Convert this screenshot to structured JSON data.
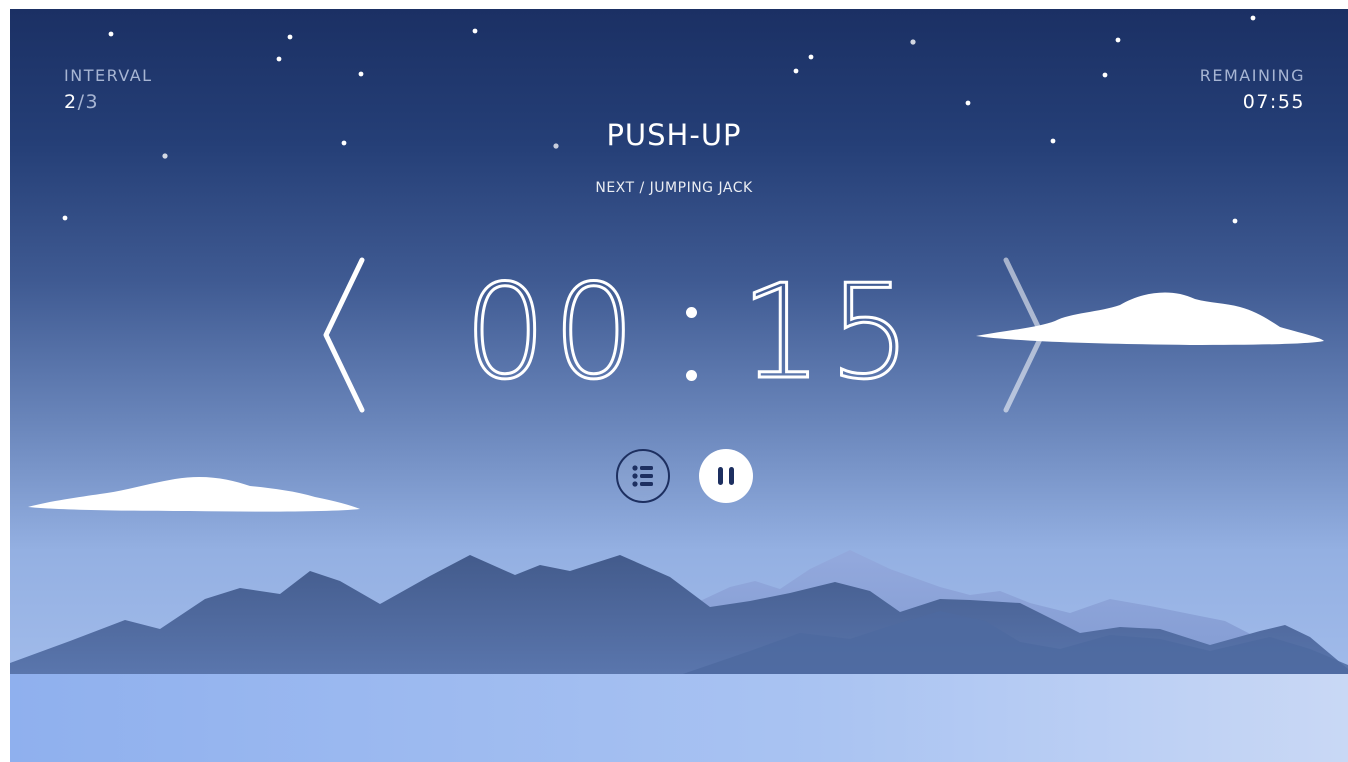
{
  "interval": {
    "label": "INTERVAL",
    "current": "2",
    "total": "/3"
  },
  "remaining": {
    "label": "REMAINING",
    "value": "07:55"
  },
  "exercise": {
    "current": "PUSH-UP",
    "next": "NEXT / JUMPING JACK"
  },
  "timer": {
    "minutes": "00",
    "seconds": "15"
  },
  "controls": {
    "prev_icon": "chevron-left-icon",
    "next_icon": "chevron-right-icon",
    "list_icon": "list-icon",
    "pause_icon": "pause-icon"
  },
  "colors": {
    "sky_top": "#1b3064",
    "sky_bottom": "#a9c2f0",
    "mountain_front": "#4a6394",
    "mountain_back": "#8da4d6",
    "button_dark": "#1d2f60",
    "text": "#ffffff"
  }
}
